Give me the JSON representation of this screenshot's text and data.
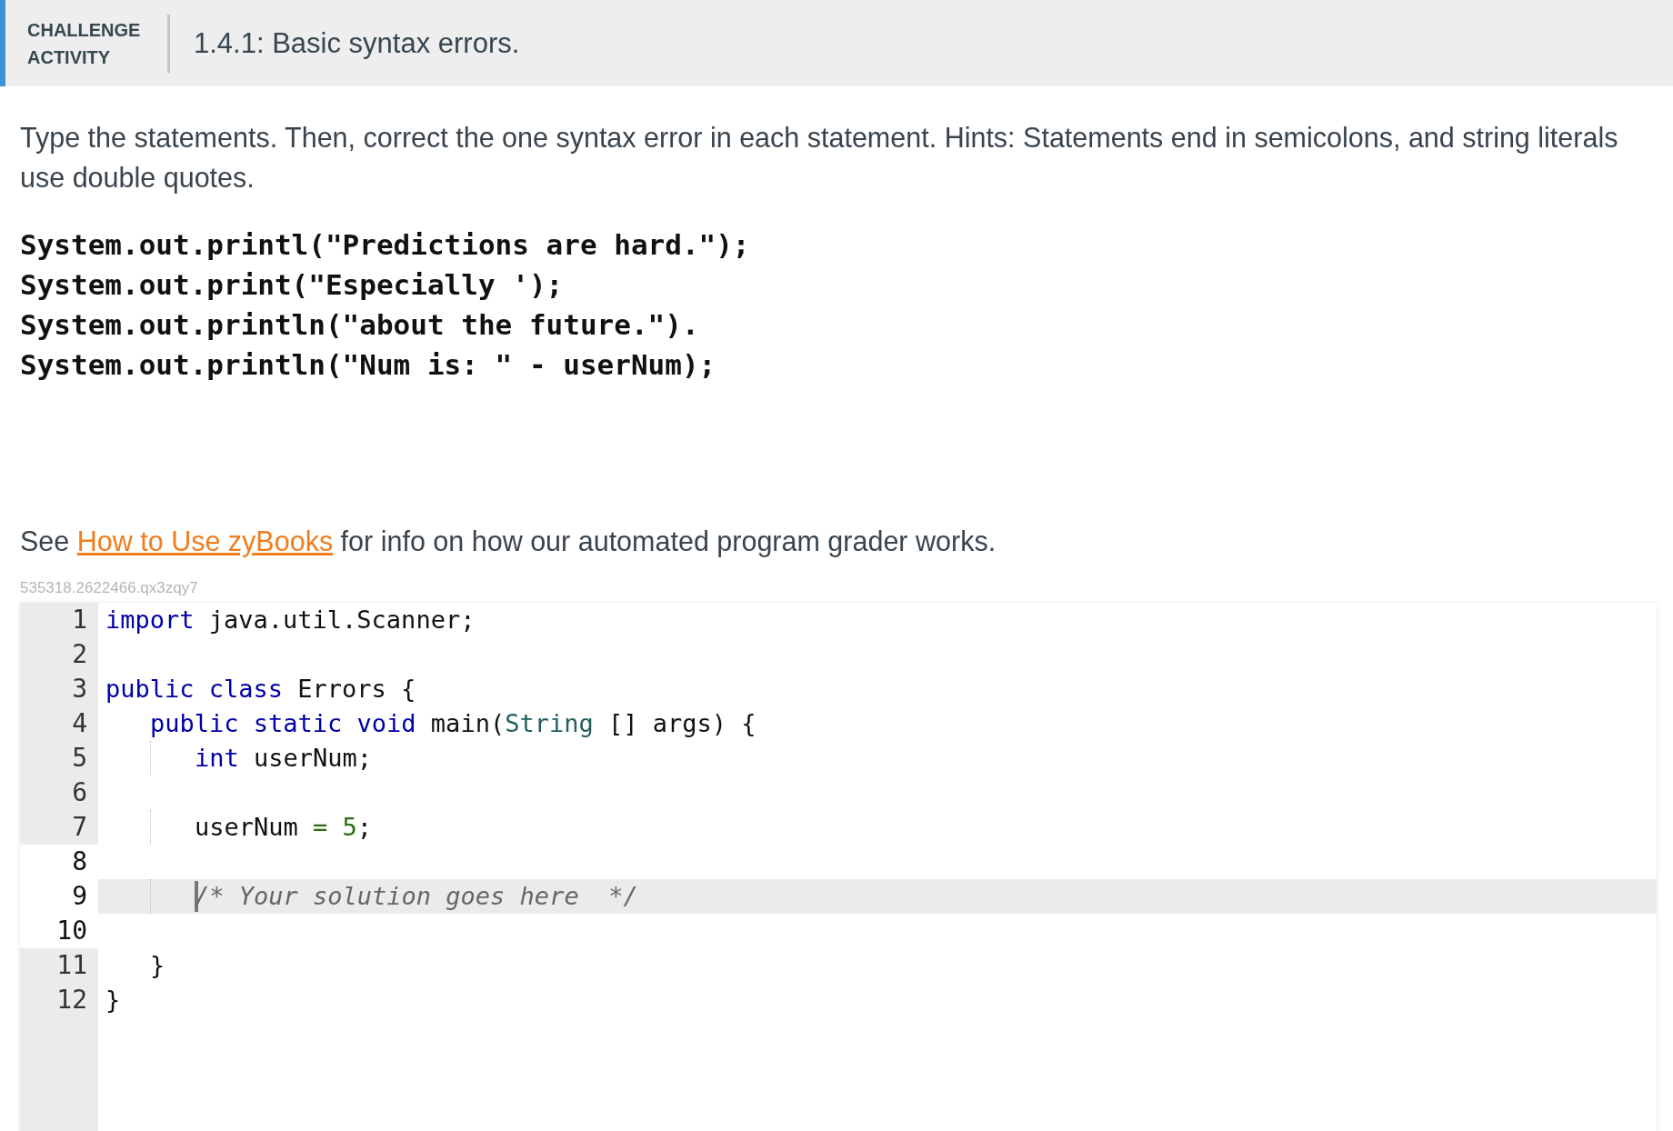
{
  "header": {
    "label": "CHALLENGE ACTIVITY",
    "title": "1.4.1: Basic syntax errors."
  },
  "instructions": "Type the statements. Then, correct the one syntax error in each statement. Hints: Statements end in semicolons, and string literals use double quotes.",
  "statements": [
    "System.out.printl(\"Predictions are hard.\");",
    "System.out.print(\"Especially ');",
    "System.out.println(\"about the future.\").",
    "System.out.println(\"Num is: \" - userNum);"
  ],
  "info": {
    "before": "See ",
    "link": "How to Use zyBooks",
    "after": " for info on how our automated program grader works."
  },
  "activity_id": "535318.2622466.qx3zqy7",
  "editor": {
    "lines": [
      {
        "number": "1",
        "kind": "top",
        "gutter_highlight": false,
        "active": false,
        "tokens": [
          {
            "kind": "keyword",
            "text": "import"
          },
          {
            "kind": "plain",
            "text": " java.util.Scanner;"
          }
        ]
      },
      {
        "number": "2",
        "kind": "blank",
        "gutter_highlight": false,
        "active": false
      },
      {
        "number": "3",
        "kind": "top",
        "gutter_highlight": false,
        "active": false,
        "tokens": [
          {
            "kind": "keyword",
            "text": "public class"
          },
          {
            "kind": "plain",
            "text": " Errors {"
          }
        ]
      },
      {
        "number": "4",
        "kind": "member",
        "gutter_highlight": false,
        "active": false,
        "tokens": [
          {
            "kind": "keyword",
            "text": "public static void"
          },
          {
            "kind": "plain",
            "text": " main("
          },
          {
            "kind": "type",
            "text": "String"
          },
          {
            "kind": "plain",
            "text": " [] args) {"
          }
        ]
      },
      {
        "number": "5",
        "kind": "statement",
        "gutter_highlight": false,
        "active": false,
        "tokens": [
          {
            "kind": "keyword",
            "text": "int"
          },
          {
            "kind": "plain",
            "text": " userNum;"
          }
        ]
      },
      {
        "number": "6",
        "kind": "blank",
        "gutter_highlight": false,
        "active": false
      },
      {
        "number": "7",
        "kind": "statement",
        "gutter_highlight": false,
        "active": false,
        "tokens": [
          {
            "kind": "plain",
            "text": "userNum "
          },
          {
            "kind": "operator",
            "text": "= "
          },
          {
            "kind": "number",
            "text": "5"
          },
          {
            "kind": "plain",
            "text": ";"
          }
        ]
      },
      {
        "number": "8",
        "kind": "blank",
        "gutter_highlight": true,
        "active": false
      },
      {
        "number": "9",
        "kind": "statement",
        "gutter_highlight": true,
        "active": true,
        "cursor": true,
        "tokens": [
          {
            "kind": "comment",
            "text": "/* Your solution goes here  */"
          }
        ]
      },
      {
        "number": "10",
        "kind": "blank",
        "gutter_highlight": true,
        "active": false
      },
      {
        "number": "11",
        "kind": "member",
        "gutter_highlight": false,
        "active": false,
        "tokens": [
          {
            "kind": "plain",
            "text": "}"
          }
        ]
      },
      {
        "number": "12",
        "kind": "top",
        "gutter_highlight": false,
        "active": false,
        "tokens": [
          {
            "kind": "plain",
            "text": "}"
          }
        ]
      }
    ]
  }
}
